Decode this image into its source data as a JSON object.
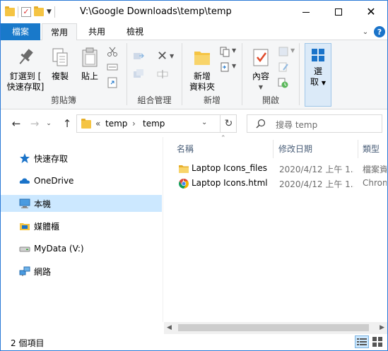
{
  "window": {
    "title": "V:\\Google Downloads\\temp\\temp"
  },
  "ribbon_tabs": {
    "file": "檔案",
    "home": "常用",
    "share": "共用",
    "view": "檢視"
  },
  "ribbon": {
    "clipboard": {
      "pin_label_1": "釘選到 [",
      "pin_label_2": "快速存取]",
      "copy_label": "複製",
      "paste_label": "貼上",
      "group_label": "剪貼簿"
    },
    "organize": {
      "group_label": "組合管理"
    },
    "new": {
      "new_folder_label_1": "新增",
      "new_folder_label_2": "資料夾",
      "group_label": "新增"
    },
    "open": {
      "properties_label": "內容",
      "group_label": "開啟"
    },
    "select": {
      "select_label_1": "選",
      "select_label_2": "取"
    }
  },
  "address_bar": {
    "overflow": "«",
    "segments": [
      "temp",
      "temp"
    ],
    "separator": "›"
  },
  "search": {
    "placeholder": "搜尋 temp"
  },
  "sidebar": {
    "items": [
      {
        "label": "快速存取",
        "icon": "star-icon"
      },
      {
        "label": "OneDrive",
        "icon": "cloud-icon"
      },
      {
        "label": "本機",
        "icon": "computer-icon",
        "selected": true
      },
      {
        "label": "媒體櫃",
        "icon": "library-icon"
      },
      {
        "label": "MyData (V:)",
        "icon": "drive-icon"
      },
      {
        "label": "網路",
        "icon": "network-icon"
      }
    ]
  },
  "columns": {
    "name": "名稱",
    "date": "修改日期",
    "type": "類型"
  },
  "files": [
    {
      "name": "Laptop Icons_files",
      "date": "2020/4/12 上午 1...",
      "type": "檔案資",
      "icon": "folder-icon"
    },
    {
      "name": "Laptop Icons.html",
      "date": "2020/4/12 上午 1...",
      "type": "Chrom",
      "icon": "chrome-icon"
    }
  ],
  "status": {
    "count_text": "2 個項目"
  },
  "colors": {
    "accent": "#1979ca",
    "selection": "#cce8ff",
    "folder": "#f5c443"
  }
}
